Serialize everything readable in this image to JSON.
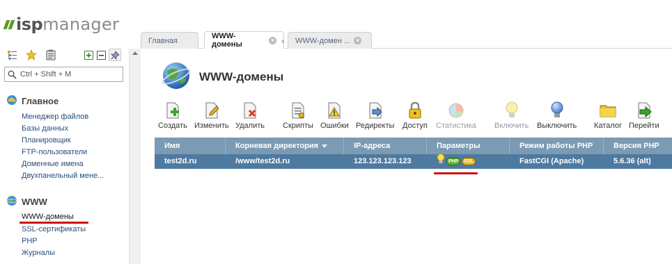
{
  "app": {
    "logo_isp": "isp",
    "logo_manager": "manager"
  },
  "search": {
    "placeholder": "Ctrl + Shift + M"
  },
  "sidebar": {
    "sections": [
      {
        "title": "Главное",
        "icon": "home-globe-icon",
        "items": [
          "Менеджер файлов",
          "Базы данных",
          "Планировщик",
          "FTP-пользователи",
          "Доменные имена",
          "Двухпанельный мене..."
        ]
      },
      {
        "title": "WWW",
        "icon": "www-globe-icon",
        "items": [
          "WWW-домены",
          "SSL-сертификаты",
          "PHP",
          "Журналы"
        ],
        "active_item": "WWW-домены"
      }
    ]
  },
  "tabs": [
    {
      "label": "Главная",
      "closable": false
    },
    {
      "label": "WWW-домены",
      "closable": true,
      "active": true
    },
    {
      "label": "WWW-домен ...",
      "closable": true
    }
  ],
  "page": {
    "title": "WWW-домены",
    "icon": "globe-icon"
  },
  "toolbar": [
    {
      "label": "Создать",
      "icon": "create-icon"
    },
    {
      "label": "Изменить",
      "icon": "edit-icon"
    },
    {
      "label": "Удалить",
      "icon": "delete-icon"
    },
    {
      "label": "Скрипты",
      "icon": "scripts-icon"
    },
    {
      "label": "Ошибки",
      "icon": "errors-icon"
    },
    {
      "label": "Редиректы",
      "icon": "redirects-icon"
    },
    {
      "label": "Доступ",
      "icon": "lock-icon"
    },
    {
      "label": "Статистика",
      "icon": "statistics-icon",
      "disabled": true
    },
    {
      "label": "Включить",
      "icon": "bulb-on-icon",
      "disabled": true
    },
    {
      "label": "Выключить",
      "icon": "bulb-off-icon"
    },
    {
      "label": "Каталог",
      "icon": "folder-icon"
    },
    {
      "label": "Перейти",
      "icon": "goto-icon"
    }
  ],
  "table": {
    "columns": [
      "Имя",
      "Корневая директория",
      "IP-адреса",
      "Параметры",
      "Режим работы PHP",
      "Версия PHP"
    ],
    "sorted_column": "Корневая директория",
    "rows": [
      {
        "name": "test2d.ru",
        "root": "/www/test2d.ru",
        "ip": "123.123.123.123",
        "params": [
          "bulb",
          "PHP",
          "SSL"
        ],
        "php_mode": "FastCGI (Apache)",
        "php_version": "5.6.36 (alt)"
      }
    ]
  },
  "colors": {
    "header_bg": "#7b9ab3",
    "selected_row_bg": "#4e7aa0",
    "logo_green": "#5a9a2a",
    "highlight_red": "#cc1111"
  }
}
